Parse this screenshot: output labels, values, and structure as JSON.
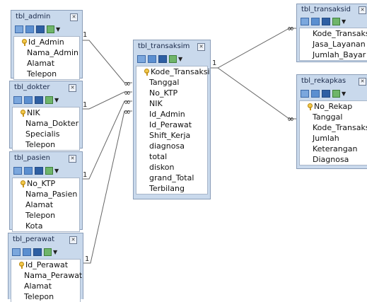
{
  "tables": [
    {
      "key": "tbl_admin",
      "title": "tbl_admin",
      "fields": [
        {
          "name": "Id_Admin",
          "pk": true
        },
        {
          "name": "Nama_Admin"
        },
        {
          "name": "Alamat"
        },
        {
          "name": "Telepon"
        }
      ]
    },
    {
      "key": "tbl_dokter",
      "title": "tbl_dokter",
      "fields": [
        {
          "name": "NIK",
          "pk": true
        },
        {
          "name": "Nama_Dokter"
        },
        {
          "name": "Specialis"
        },
        {
          "name": "Telepon"
        }
      ]
    },
    {
      "key": "tbl_pasien",
      "title": "tbl_pasien",
      "fields": [
        {
          "name": "No_KTP",
          "pk": true
        },
        {
          "name": "Nama_Pasien"
        },
        {
          "name": "Alamat"
        },
        {
          "name": "Telepon"
        },
        {
          "name": "Kota"
        }
      ]
    },
    {
      "key": "tbl_perawat",
      "title": "tbl_perawat",
      "fields": [
        {
          "name": "Id_Perawat",
          "pk": true
        },
        {
          "name": "Nama_Perawat"
        },
        {
          "name": "Alamat"
        },
        {
          "name": "Telepon"
        }
      ]
    },
    {
      "key": "tbl_transaksim",
      "title": "tbl_transaksim",
      "fields": [
        {
          "name": "Kode_Transaksi",
          "pk": true
        },
        {
          "name": "Tanggal"
        },
        {
          "name": "No_KTP"
        },
        {
          "name": "NIK"
        },
        {
          "name": "Id_Admin"
        },
        {
          "name": "Id_Perawat"
        },
        {
          "name": "Shift_Kerja"
        },
        {
          "name": "diagnosa"
        },
        {
          "name": "total"
        },
        {
          "name": "diskon"
        },
        {
          "name": "grand_Total"
        },
        {
          "name": "Terbilang"
        }
      ]
    },
    {
      "key": "tbl_transaksid",
      "title": "tbl_transaksid",
      "fields": [
        {
          "name": "Kode_Transaksi"
        },
        {
          "name": "Jasa_Layanan"
        },
        {
          "name": "Jumlah_Bayar"
        }
      ]
    },
    {
      "key": "tbl_rekapkas",
      "title": "tbl_rekapkas",
      "fields": [
        {
          "name": "No_Rekap",
          "pk": true
        },
        {
          "name": "Tanggal"
        },
        {
          "name": "Kode_Transaksi"
        },
        {
          "name": "Jumlah"
        },
        {
          "name": "Keterangan"
        },
        {
          "name": "Diagnosa"
        }
      ]
    }
  ],
  "relations": [
    {
      "from": "tbl_admin",
      "to": "tbl_transaksim",
      "from_card": "1",
      "to_card": "∞"
    },
    {
      "from": "tbl_dokter",
      "to": "tbl_transaksim",
      "from_card": "1",
      "to_card": "∞"
    },
    {
      "from": "tbl_pasien",
      "to": "tbl_transaksim",
      "from_card": "1",
      "to_card": "∞"
    },
    {
      "from": "tbl_perawat",
      "to": "tbl_transaksim",
      "from_card": "1",
      "to_card": "∞"
    },
    {
      "from": "tbl_transaksim",
      "to": "tbl_transaksid",
      "from_card": "1",
      "to_card": "∞"
    },
    {
      "from": "tbl_transaksim",
      "to": "tbl_rekapkas",
      "from_card": "1",
      "to_card": "∞"
    }
  ]
}
